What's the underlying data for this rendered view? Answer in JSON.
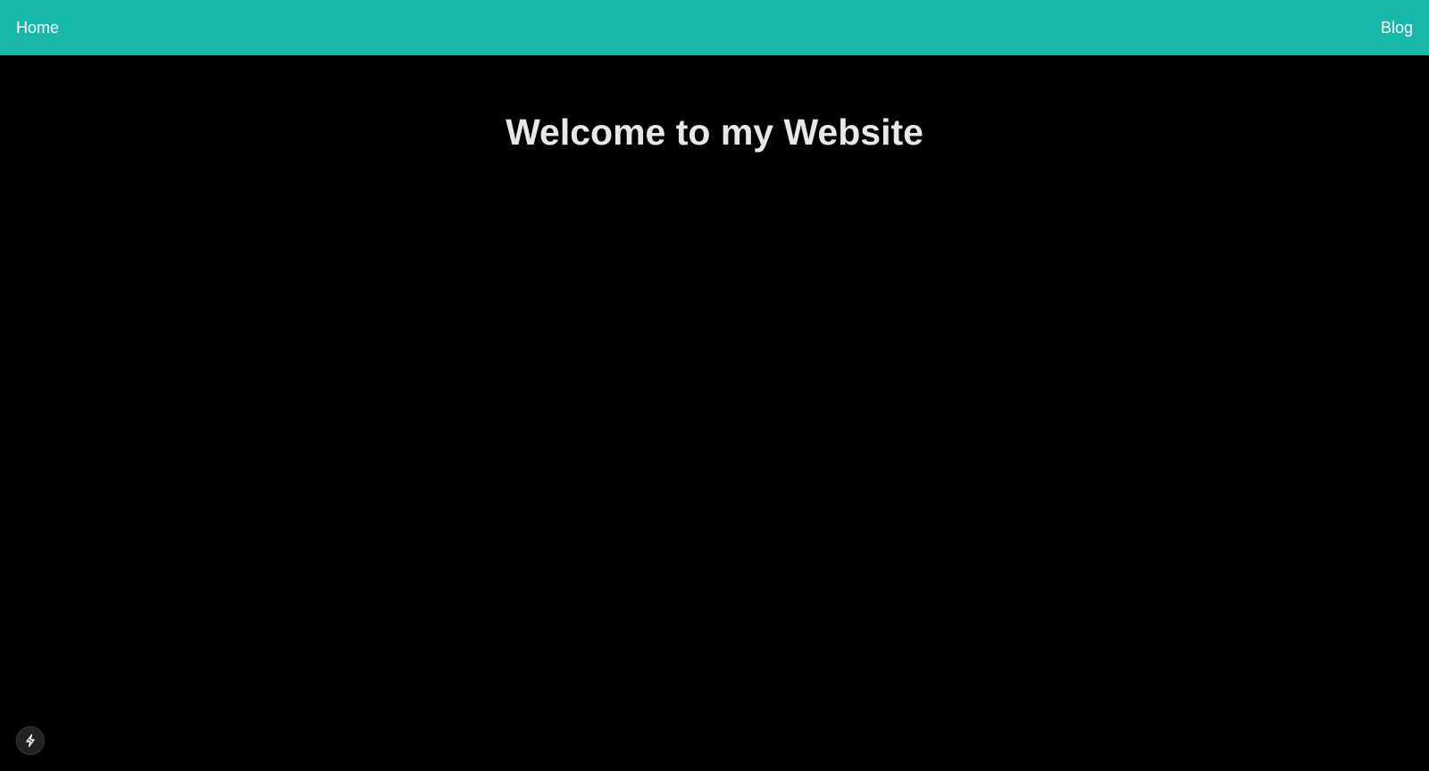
{
  "nav": {
    "home_label": "Home",
    "blog_label": "Blog"
  },
  "main": {
    "heading": "Welcome to my Website"
  },
  "dev_indicator": {
    "icon": "lightning-bolt-icon"
  },
  "colors": {
    "navbar_background": "#17b8a9",
    "page_background": "#000000",
    "heading_text": "#e8e8e8",
    "nav_text": "#ffffff"
  }
}
